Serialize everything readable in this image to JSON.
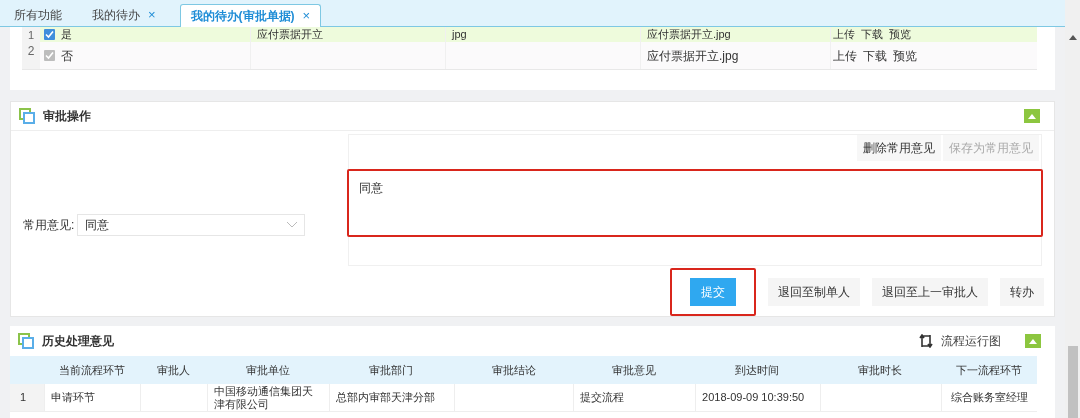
{
  "tabs": [
    {
      "label": "所有功能",
      "selected": false
    },
    {
      "label": "我的待办",
      "selected": false,
      "close": "×"
    },
    {
      "label": "我的待办(审批单据)",
      "selected": true,
      "close": "×"
    }
  ],
  "attachments": {
    "rows": [
      {
        "index": "1",
        "checked": true,
        "disabled": false,
        "selected": true,
        "required": "是",
        "column_3": "应付票据开立",
        "column_4": "jpg",
        "file": "应付票据开立.jpg",
        "actions": [
          "上传",
          "下载",
          "预览"
        ]
      },
      {
        "index": "2",
        "checked": true,
        "disabled": true,
        "selected": false,
        "required": "否",
        "column_3": "",
        "column_4": "",
        "file": "应付票据开立.jpg",
        "actions": [
          "上传",
          "下载",
          "预览"
        ]
      }
    ]
  },
  "approval": {
    "title": "审批操作",
    "common_label": "常用意见:",
    "common_value": "同意",
    "opinion_buttons": [
      {
        "label": "删除常用意见",
        "disabled": false
      },
      {
        "label": "保存为常用意见",
        "disabled": true
      }
    ],
    "opinion": "同意",
    "actions": [
      {
        "label": "提交",
        "kind": "primary",
        "highlighted": true
      },
      {
        "label": "退回至制单人",
        "kind": "default",
        "highlighted": false
      },
      {
        "label": "退回至上一审批人",
        "kind": "default",
        "highlighted": false
      },
      {
        "label": "转办",
        "kind": "default",
        "highlighted": false
      }
    ]
  },
  "history": {
    "title": "历史处理意见",
    "flow_link": "流程运行图",
    "columns": [
      "当前流程环节",
      "审批人",
      "审批单位",
      "审批部门",
      "审批结论",
      "审批意见",
      "到达时间",
      "审批时长",
      "下一流程环节"
    ],
    "rows": [
      {
        "index": "1",
        "cells": [
          "申请环节",
          "",
          "中国移动通信集团天津有限公司",
          "总部内审部天津分部",
          "",
          "提交流程",
          "2018-09-09 10:39:50",
          "",
          "综合账务室经理"
        ]
      }
    ]
  }
}
